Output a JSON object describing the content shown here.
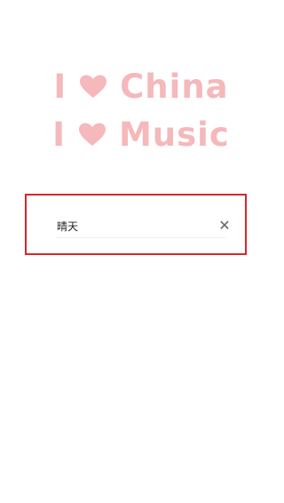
{
  "hero": {
    "line1": {
      "pronoun": "I",
      "icon": "heart-icon",
      "word": "China"
    },
    "line2": {
      "pronoun": "I",
      "icon": "heart-icon",
      "word": "Music"
    },
    "color": "#f5b8bb"
  },
  "search": {
    "value": "晴天",
    "clear_icon": "close-icon",
    "highlight_border_color": "#d9252b"
  }
}
